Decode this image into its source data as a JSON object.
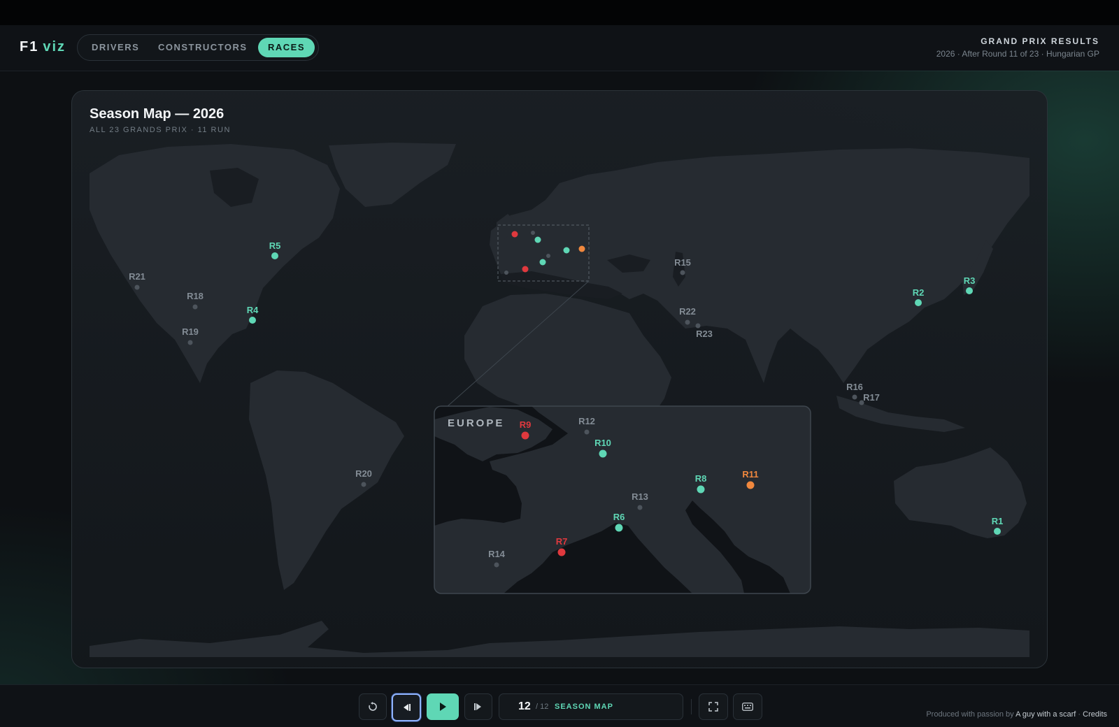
{
  "app": {
    "logo_f1": "F1",
    "logo_viz": "viz"
  },
  "nav": {
    "tabs": [
      {
        "label": "DRIVERS",
        "active": false
      },
      {
        "label": "CONSTRUCTORS",
        "active": false
      },
      {
        "label": "RACES",
        "active": true
      }
    ]
  },
  "header": {
    "title": "GRAND PRIX RESULTS",
    "subtitle": "2026 · After Round 11 of 23 · Hungarian GP"
  },
  "card": {
    "title": "Season Map — 2026",
    "subtitle": "ALL 23 GRANDS PRIX · 11 RUN"
  },
  "inset": {
    "label": "EUROPE"
  },
  "rounds": [
    {
      "label": "R1",
      "status": "completed"
    },
    {
      "label": "R2",
      "status": "completed"
    },
    {
      "label": "R3",
      "status": "completed"
    },
    {
      "label": "R4",
      "status": "completed"
    },
    {
      "label": "R5",
      "status": "completed"
    },
    {
      "label": "R6",
      "status": "completed"
    },
    {
      "label": "R7",
      "status": "highlight-red"
    },
    {
      "label": "R8",
      "status": "completed"
    },
    {
      "label": "R9",
      "status": "highlight-red"
    },
    {
      "label": "R10",
      "status": "completed"
    },
    {
      "label": "R11",
      "status": "current"
    },
    {
      "label": "R12",
      "status": "upcoming"
    },
    {
      "label": "R13",
      "status": "upcoming"
    },
    {
      "label": "R14",
      "status": "upcoming"
    },
    {
      "label": "R15",
      "status": "upcoming"
    },
    {
      "label": "R16",
      "status": "upcoming"
    },
    {
      "label": "R17",
      "status": "upcoming"
    },
    {
      "label": "R18",
      "status": "upcoming"
    },
    {
      "label": "R19",
      "status": "upcoming"
    },
    {
      "label": "R20",
      "status": "upcoming"
    },
    {
      "label": "R21",
      "status": "upcoming"
    },
    {
      "label": "R22",
      "status": "upcoming"
    },
    {
      "label": "R23",
      "status": "upcoming"
    }
  ],
  "colors": {
    "accent": "#5fd7b5",
    "red": "#e0393e",
    "orange": "#f0883e",
    "upcoming": "#4d545c"
  },
  "controls": {
    "step_current": "12",
    "step_total": "/ 12",
    "step_name": "SEASON MAP",
    "icons": [
      "restart-icon",
      "step-back-icon",
      "play-icon",
      "step-forward-icon",
      "fullscreen-icon",
      "keyboard-icon"
    ]
  },
  "footer": {
    "credits_prefix": "Produced with passion by",
    "credits_author": "A guy with a scarf",
    "credits_sep": "·",
    "credits_link": "Credits"
  }
}
